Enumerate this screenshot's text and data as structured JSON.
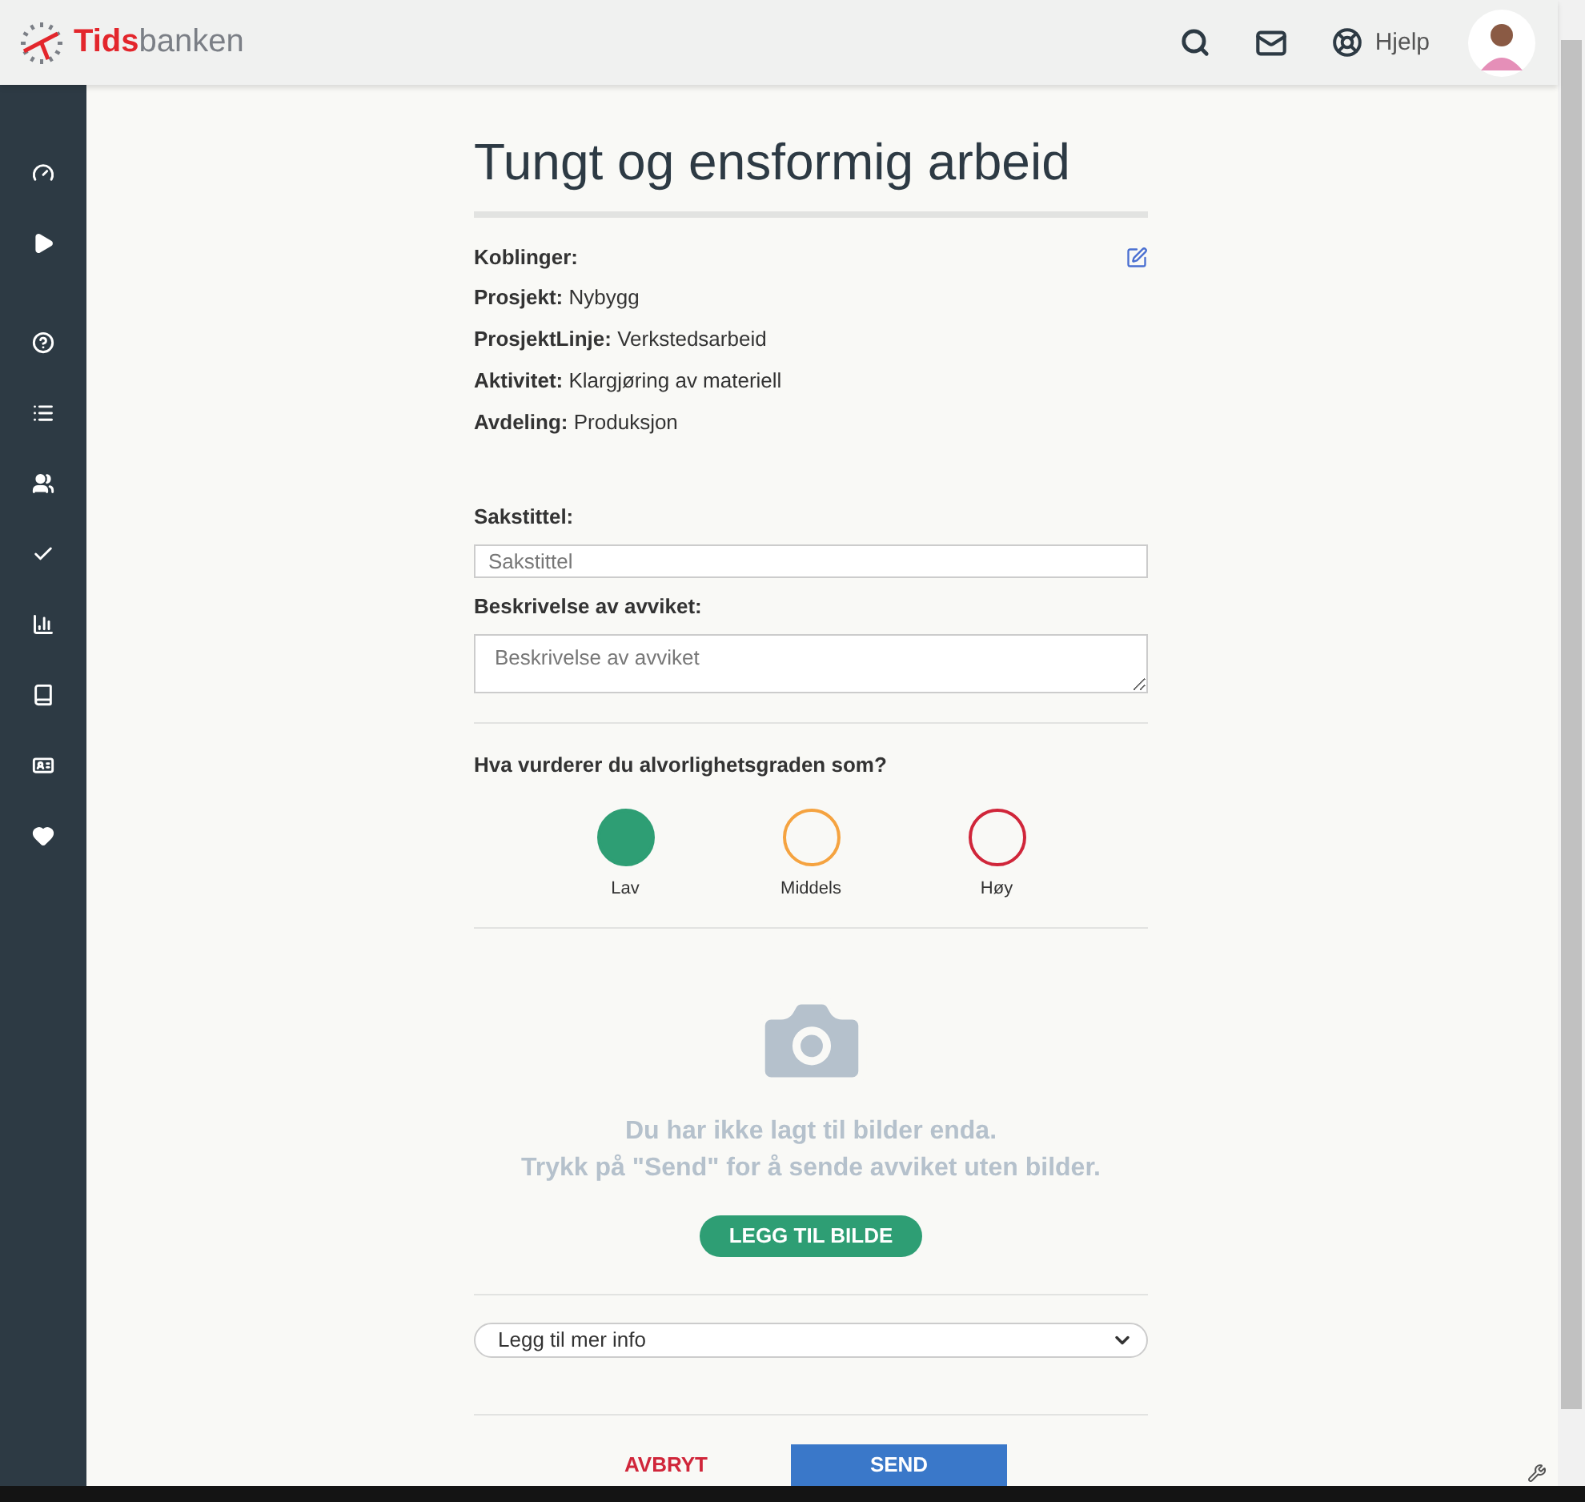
{
  "brand": {
    "first": "Tids",
    "second": "banken"
  },
  "header": {
    "help": "Hjelp"
  },
  "form": {
    "title": "Tungt og ensformig arbeid",
    "links_heading": "Koblinger:",
    "links": [
      {
        "label": "Prosjekt:",
        "value": "Nybygg"
      },
      {
        "label": "ProsjektLinje:",
        "value": "Verkstedsarbeid"
      },
      {
        "label": "Aktivitet:",
        "value": "Klargjøring av materiell"
      },
      {
        "label": "Avdeling:",
        "value": "Produksjon"
      }
    ],
    "case_title": {
      "label": "Sakstittel:",
      "placeholder": "Sakstittel"
    },
    "description": {
      "label": "Beskrivelse av avviket:",
      "placeholder": "Beskrivelse av avviket"
    },
    "severity": {
      "question": "Hva vurderer du alvorlighetsgraden som?",
      "options": [
        {
          "label": "Lav",
          "color": "#2e9e74",
          "selected": true
        },
        {
          "label": "Middels",
          "color": "#f5a340",
          "selected": false
        },
        {
          "label": "Høy",
          "color": "#d0263a",
          "selected": false
        }
      ]
    },
    "images": {
      "empty_line1": "Du har ikke lagt til bilder enda.",
      "empty_line2": "Trykk på \"Send\" for å sende avviket uten bilder.",
      "add_button": "LEGG TIL BILDE"
    },
    "more_info": {
      "value": "Legg til mer info"
    },
    "cancel": "AVBRYT",
    "send": "SEND"
  }
}
